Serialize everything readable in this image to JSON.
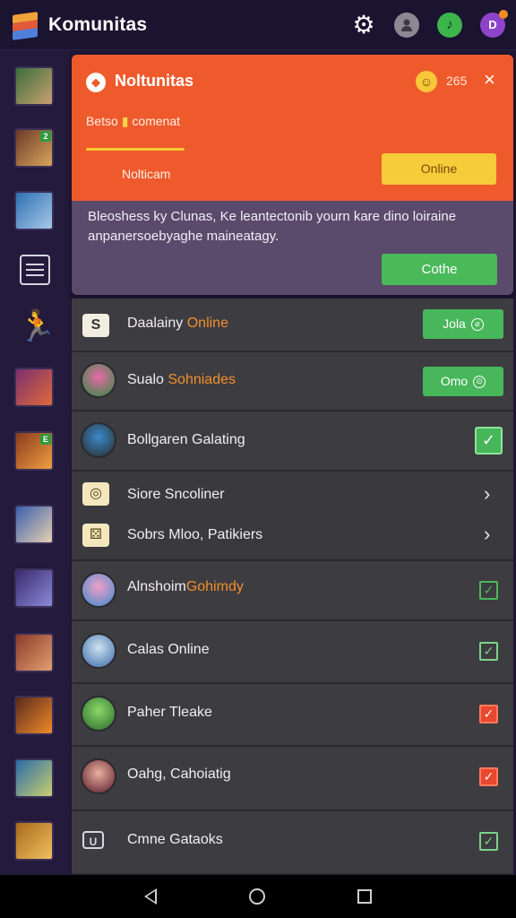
{
  "app": {
    "title": "Komunitas"
  },
  "topbar": {
    "icons": [
      "gear-icon",
      "user-icon",
      "music-icon",
      "chat-icon"
    ],
    "music_glyph": "♪",
    "chat_glyph": "D"
  },
  "rail": {
    "items": [
      {
        "name": "game-avatar-1",
        "color1": "#3b6e3b",
        "color2": "#c9a070"
      },
      {
        "name": "game-avatar-2",
        "color1": "#6b3a2a",
        "color2": "#d9a45a",
        "badge": "2"
      },
      {
        "name": "game-avatar-3",
        "color1": "#2f6fb3",
        "color2": "#a6c8e8"
      },
      {
        "name": "game-avatar-4",
        "color1": "#7a2f6e",
        "color2": "#e0693a"
      },
      {
        "name": "game-avatar-5",
        "color1": "#8a3a1e",
        "color2": "#f0a040",
        "badge": "E"
      },
      {
        "name": "game-avatar-6",
        "color1": "#3a5fae",
        "color2": "#e8d0b0"
      },
      {
        "name": "game-avatar-7",
        "color1": "#3a2a6e",
        "color2": "#8a8ad8"
      },
      {
        "name": "game-avatar-8",
        "color1": "#8a3a2a",
        "color2": "#e3a070"
      },
      {
        "name": "game-avatar-9",
        "color1": "#5a2a1a",
        "color2": "#f08a2a"
      },
      {
        "name": "game-avatar-10",
        "color1": "#2a6aa8",
        "color2": "#c9d070"
      },
      {
        "name": "game-avatar-11",
        "color1": "#a86a1a",
        "color2": "#f0c060"
      }
    ],
    "figure_glyph": "🏃"
  },
  "notification": {
    "title": "Noltunitas",
    "count": "265",
    "emoji": "☺",
    "close": "×",
    "subtitle_pre": "Betso",
    "subtitle_post": "comenat",
    "label": "Nolticam",
    "online_button": "Online",
    "body": "Bleoshess ky Clunas, Ke leantectonib yourn kare dino loiraine anpanersoebyaghe maineatagy.",
    "action_button": "Cothe"
  },
  "list": {
    "rows": [
      {
        "label": "Daalainy",
        "highlight": "Online",
        "button": "Jola",
        "button_glyph": "⌀"
      },
      {
        "label": "Sualo",
        "highlight": "Sohniades",
        "button": "Omo",
        "button_glyph": "⊙"
      },
      {
        "label": "Bollgaren Galating",
        "check": "✓"
      },
      {
        "label": "Siore Sncoliner",
        "chevron": "›"
      },
      {
        "label": "Sobrs Mloo, Patikiers",
        "chevron": "›"
      },
      {
        "label": "Alnshoim",
        "highlight": "Gohimdy",
        "check": "✓"
      },
      {
        "label": "Calas Online",
        "check": "✓"
      },
      {
        "label": "Paher Tleake",
        "check": "✓"
      },
      {
        "label": "Oahg, Cahoiatig",
        "check": "✓"
      },
      {
        "label": "Cmne Gataoks",
        "check": "✓"
      }
    ]
  },
  "colors": {
    "accent_orange": "#ef5a2c",
    "accent_green": "#48b65a",
    "accent_yellow": "#f6cc3a",
    "highlight_text": "#f2902b",
    "check_red": "#e8482e"
  }
}
